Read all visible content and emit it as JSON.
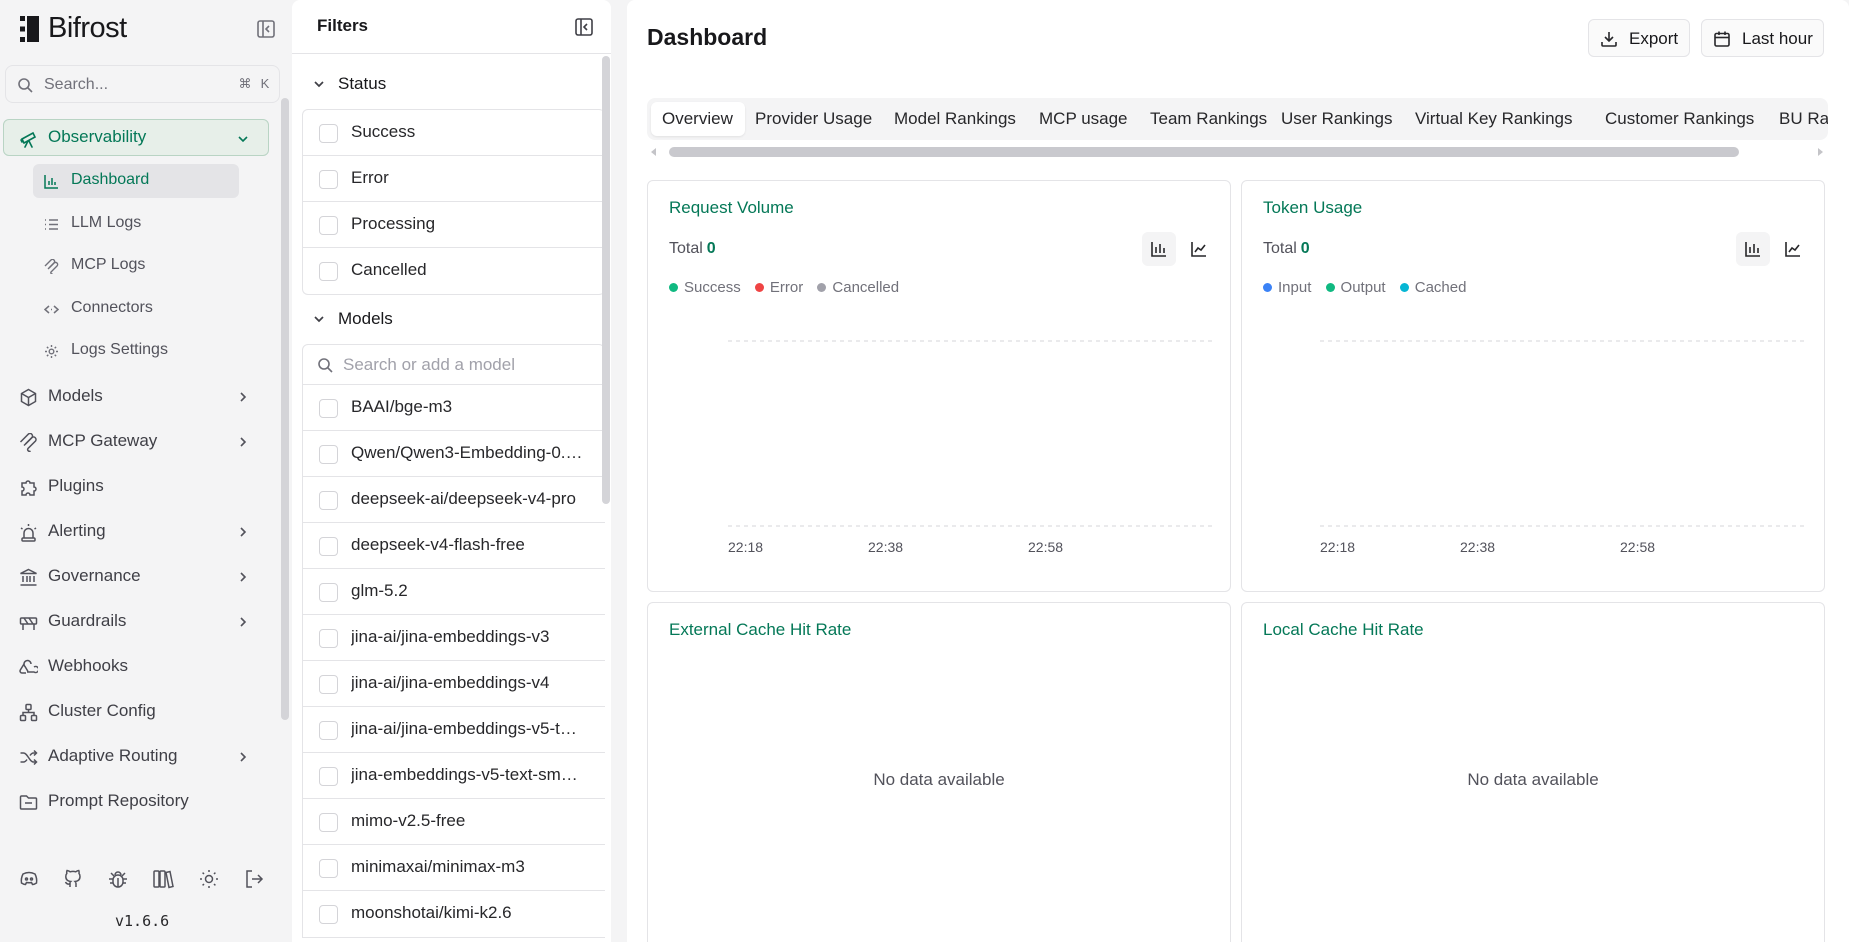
{
  "app": {
    "name": "Bifrost",
    "version": "v1.6.6"
  },
  "search": {
    "placeholder": "Search...",
    "shortcut_mod": "⌘",
    "shortcut_key": "K"
  },
  "sidebar": {
    "observability": {
      "label": "Observability",
      "icon": "telescope-icon",
      "expanded": true,
      "children": [
        {
          "label": "Dashboard",
          "icon": "bar-chart-icon",
          "active": true
        },
        {
          "label": "LLM Logs",
          "icon": "list-icon"
        },
        {
          "label": "MCP Logs",
          "icon": "mcp-icon"
        },
        {
          "label": "Connectors",
          "icon": "code-arrows-icon"
        },
        {
          "label": "Logs Settings",
          "icon": "gear-icon"
        }
      ]
    },
    "items": [
      {
        "label": "Models",
        "icon": "cube-icon",
        "has_children": true
      },
      {
        "label": "MCP Gateway",
        "icon": "mcp-icon",
        "has_children": true
      },
      {
        "label": "Plugins",
        "icon": "puzzle-icon",
        "has_children": false
      },
      {
        "label": "Alerting",
        "icon": "siren-icon",
        "has_children": true
      },
      {
        "label": "Governance",
        "icon": "landmark-icon",
        "has_children": true
      },
      {
        "label": "Guardrails",
        "icon": "construction-icon",
        "has_children": true
      },
      {
        "label": "Webhooks",
        "icon": "webhook-icon",
        "has_children": false
      },
      {
        "label": "Cluster Config",
        "icon": "network-icon",
        "has_children": false
      },
      {
        "label": "Adaptive Routing",
        "icon": "shuffle-icon",
        "has_children": true
      },
      {
        "label": "Prompt Repository",
        "icon": "folder-icon",
        "has_children": false
      }
    ],
    "bottom_icons": [
      "discord-icon",
      "github-icon",
      "bug-icon",
      "docs-icon",
      "theme-toggle-icon",
      "logout-icon"
    ]
  },
  "filters": {
    "title": "Filters",
    "status": {
      "label": "Status",
      "options": [
        "Success",
        "Error",
        "Processing",
        "Cancelled"
      ]
    },
    "models": {
      "label": "Models",
      "search_placeholder": "Search or add a model",
      "options": [
        "BAAI/bge-m3",
        "Qwen/Qwen3-Embedding-0.…",
        "deepseek-ai/deepseek-v4-pro",
        "deepseek-v4-flash-free",
        "glm-5.2",
        "jina-ai/jina-embeddings-v3",
        "jina-ai/jina-embeddings-v4",
        "jina-ai/jina-embeddings-v5-t…",
        "jina-embeddings-v5-text-sm…",
        "mimo-v2.5-free",
        "minimaxai/minimax-m3",
        "moonshotai/kimi-k2.6"
      ]
    }
  },
  "main": {
    "title": "Dashboard",
    "export_label": "Export",
    "time_range_label": "Last hour",
    "tabs": [
      {
        "label": "Overview",
        "active": true
      },
      {
        "label": "Provider Usage"
      },
      {
        "label": "Model Rankings"
      },
      {
        "label": "MCP usage"
      },
      {
        "label": "Team Rankings"
      },
      {
        "label": "User Rankings"
      },
      {
        "label": "Virtual Key Rankings"
      },
      {
        "label": "Customer Rankings"
      },
      {
        "label": "BU Ra"
      }
    ],
    "cards": {
      "request_volume": {
        "title": "Request Volume",
        "total_label": "Total",
        "total_value": "0",
        "legend": [
          {
            "label": "Success",
            "color": "#10b981"
          },
          {
            "label": "Error",
            "color": "#ef4444"
          },
          {
            "label": "Cancelled",
            "color": "#a1a1aa"
          }
        ],
        "x_ticks": [
          "22:18",
          "22:38",
          "22:58"
        ]
      },
      "token_usage": {
        "title": "Token Usage",
        "total_label": "Total",
        "total_value": "0",
        "legend": [
          {
            "label": "Input",
            "color": "#3b82f6"
          },
          {
            "label": "Output",
            "color": "#10b981"
          },
          {
            "label": "Cached",
            "color": "#06b6d4"
          }
        ],
        "x_ticks": [
          "22:18",
          "22:38",
          "22:58"
        ]
      },
      "external_cache": {
        "title": "External Cache Hit Rate",
        "empty_text": "No data available"
      },
      "local_cache": {
        "title": "Local Cache Hit Rate",
        "empty_text": "No data available"
      }
    }
  },
  "colors": {
    "accent": "#047857",
    "active_bg": "#e7efe9"
  }
}
